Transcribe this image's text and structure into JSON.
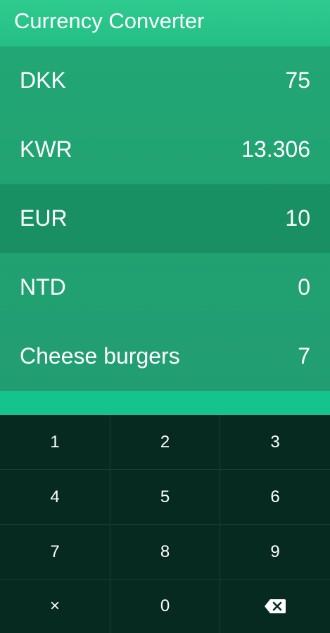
{
  "header": {
    "title": "Currency Converter"
  },
  "rows": [
    {
      "label": "DKK",
      "value": "75"
    },
    {
      "label": "KWR",
      "value": "13.306"
    },
    {
      "label": "EUR",
      "value": "10"
    },
    {
      "label": "NTD",
      "value": "0"
    },
    {
      "label": "Cheese burgers",
      "value": "7"
    }
  ],
  "keypad": {
    "keys": [
      "1",
      "2",
      "3",
      "4",
      "5",
      "6",
      "7",
      "8",
      "9",
      "×",
      "0"
    ],
    "backspace_icon": "backspace-icon"
  },
  "colors": {
    "header_bg": "#2fca8e",
    "rows_bg": "#22a473",
    "accent_bar": "#14c48c",
    "keypad_bg": "#072a20",
    "text": "#ffffff"
  }
}
